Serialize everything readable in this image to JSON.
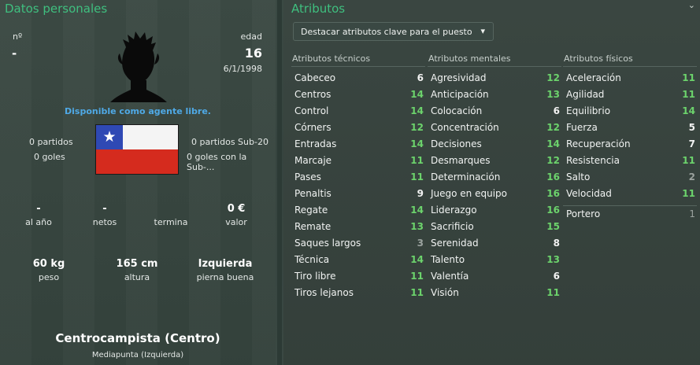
{
  "personal": {
    "title": "Datos personales",
    "number_label": "nº",
    "number_value": "-",
    "age_label": "edad",
    "age_value": "16",
    "birth_date": "6/1/1998",
    "free_agent": "Disponible como agente libre.",
    "matches_left": "0 partidos",
    "goals_left": "0 goles",
    "matches_u20": "0 partidos Sub-20",
    "goals_u20": "0 goles con la Sub-...",
    "salary_value": "-",
    "salary_label": "al año",
    "net_value": "-",
    "net_label": "netos",
    "ends_label": "termina",
    "value_value": "0 €",
    "value_label": "valor",
    "weight_value": "60 kg",
    "weight_label": "peso",
    "height_value": "165 cm",
    "height_label": "altura",
    "foot_value": "Izquierda",
    "foot_label": "pierna buena",
    "position_main": "Centrocampista (Centro)",
    "position_secondary": "Mediapunta (Izquierda)",
    "flag_colors": {
      "blue": "#2f49b4",
      "white": "#f4f4f4",
      "red": "#d52b1e"
    }
  },
  "attributes": {
    "title": "Atributos",
    "dropdown_label": "Destacar atributos clave para el puesto",
    "technical": {
      "header": "Atributos técnicos",
      "items": [
        {
          "name": "Cabeceo",
          "value": "6"
        },
        {
          "name": "Centros",
          "value": "14"
        },
        {
          "name": "Control",
          "value": "14"
        },
        {
          "name": "Córners",
          "value": "12"
        },
        {
          "name": "Entradas",
          "value": "14"
        },
        {
          "name": "Marcaje",
          "value": "11"
        },
        {
          "name": "Pases",
          "value": "11"
        },
        {
          "name": "Penaltis",
          "value": "9"
        },
        {
          "name": "Regate",
          "value": "14"
        },
        {
          "name": "Remate",
          "value": "13"
        },
        {
          "name": "Saques largos",
          "value": "3"
        },
        {
          "name": "Técnica",
          "value": "14"
        },
        {
          "name": "Tiro libre",
          "value": "11"
        },
        {
          "name": "Tiros lejanos",
          "value": "11"
        }
      ]
    },
    "mental": {
      "header": "Atributos mentales",
      "items": [
        {
          "name": "Agresividad",
          "value": "12"
        },
        {
          "name": "Anticipación",
          "value": "13"
        },
        {
          "name": "Colocación",
          "value": "6"
        },
        {
          "name": "Concentración",
          "value": "12"
        },
        {
          "name": "Decisiones",
          "value": "14"
        },
        {
          "name": "Desmarques",
          "value": "12"
        },
        {
          "name": "Determinación",
          "value": "16"
        },
        {
          "name": "Juego en equipo",
          "value": "16"
        },
        {
          "name": "Liderazgo",
          "value": "16"
        },
        {
          "name": "Sacrificio",
          "value": "15"
        },
        {
          "name": "Serenidad",
          "value": "8"
        },
        {
          "name": "Talento",
          "value": "13"
        },
        {
          "name": "Valentía",
          "value": "6"
        },
        {
          "name": "Visión",
          "value": "11"
        }
      ]
    },
    "physical": {
      "header": "Atributos físicos",
      "items": [
        {
          "name": "Aceleración",
          "value": "11"
        },
        {
          "name": "Agilidad",
          "value": "11"
        },
        {
          "name": "Equilibrio",
          "value": "14"
        },
        {
          "name": "Fuerza",
          "value": "5"
        },
        {
          "name": "Recuperación",
          "value": "7"
        },
        {
          "name": "Resistencia",
          "value": "11"
        },
        {
          "name": "Salto",
          "value": "2"
        },
        {
          "name": "Velocidad",
          "value": "11"
        }
      ],
      "extra": {
        "name": "Portero",
        "value": "1"
      }
    },
    "colors": {
      "high": "#6cd36c",
      "mid": "#f2f2f2",
      "low": "#9aa29e"
    }
  }
}
